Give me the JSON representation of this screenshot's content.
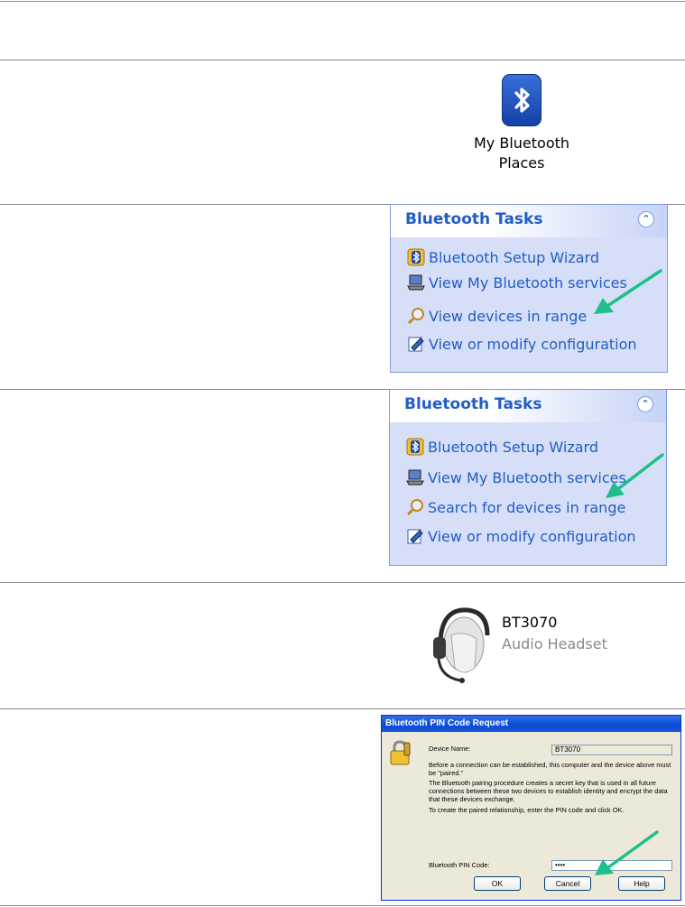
{
  "places": {
    "label_line1": "My Bluetooth",
    "label_line2": "Places"
  },
  "pane1": {
    "title": "Bluetooth Tasks",
    "collapse_glyph": "⌃",
    "tasks": [
      {
        "label": "Bluetooth Setup Wizard",
        "icon": "bluetooth-wizard-icon"
      },
      {
        "label": "View My Bluetooth services",
        "icon": "laptop-icon"
      },
      {
        "label": "View devices in range",
        "icon": "magnifier-icon"
      },
      {
        "label": "View or modify configuration",
        "icon": "configuration-icon"
      }
    ]
  },
  "pane2": {
    "title": "Bluetooth Tasks",
    "collapse_glyph": "⌃",
    "tasks": [
      {
        "label": "Bluetooth Setup Wizard",
        "icon": "bluetooth-wizard-icon"
      },
      {
        "label": "View My Bluetooth services",
        "icon": "laptop-icon"
      },
      {
        "label": "Search for devices in range",
        "icon": "magnifier-icon"
      },
      {
        "label": "View or modify configuration",
        "icon": "configuration-icon"
      }
    ]
  },
  "device": {
    "name": "BT3070",
    "type": "Audio Headset"
  },
  "dialog": {
    "title": "Bluetooth PIN Code Request",
    "device_name_label": "Device Name:",
    "device_name_value": "BT3070",
    "para1": "Before a connection can be established, this computer and the device above must be \"paired.\"",
    "para2": "The Bluetooth pairing procedure creates a secret key that is used in all future connections between these two devices to establish identity and encrypt the data that these devices exchange.",
    "para3": "To create the paired relationship, enter the PIN code and click OK.",
    "pin_label": "Bluetooth PIN Code:",
    "pin_value": "••••",
    "ok": "OK",
    "cancel": "Cancel",
    "help": "Help"
  },
  "colors": {
    "accent": "#215dc6",
    "pane_bg": "#d6dff7",
    "arrow": "#1fbf8a",
    "dialog_title": "#0b4bd6"
  }
}
